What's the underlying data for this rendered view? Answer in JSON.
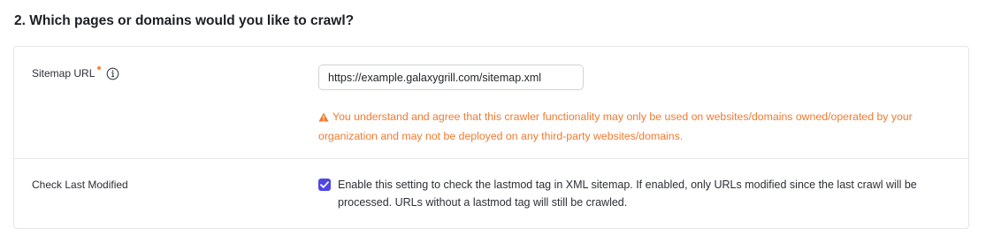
{
  "section": {
    "title": "2. Which pages or domains would you like to crawl?"
  },
  "sitemap": {
    "label": "Sitemap URL",
    "input_value": "https://example.galaxygrill.com/sitemap.xml",
    "warning": "You understand and agree that this crawler functionality may only be used on websites/domains owned/operated by your organization and may not be deployed on any third-party websites/domains.",
    "info_icon": "info-icon",
    "warning_icon": "warning-triangle-icon"
  },
  "last_modified": {
    "label": "Check Last Modified",
    "checked": true,
    "description": "Enable this setting to check the lastmod tag in XML sitemap. If enabled, only URLs modified since the last crawl will be processed. URLs without a lastmod tag will still be crawled."
  },
  "colors": {
    "accent": "#4f46e5",
    "warning": "#f07a30",
    "required": "#f08a3c",
    "border": "#e4e6ea"
  }
}
